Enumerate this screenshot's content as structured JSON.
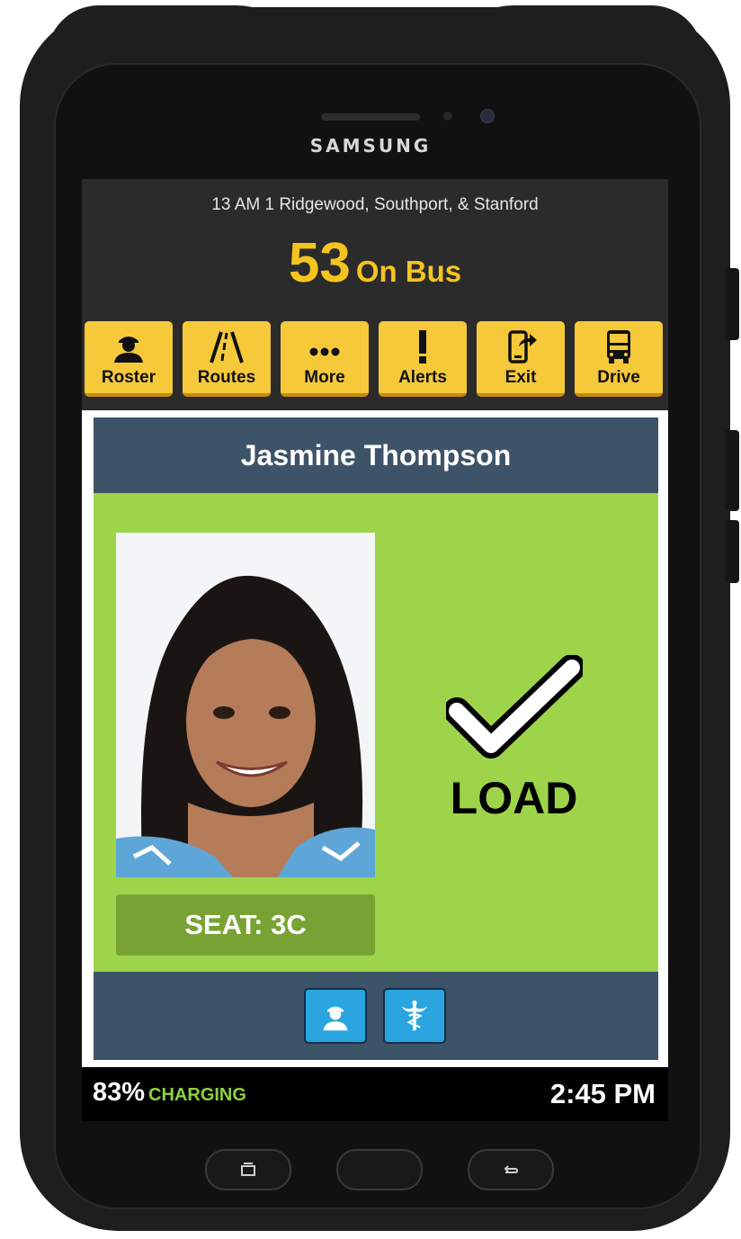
{
  "device": {
    "brand": "SAMSUNG"
  },
  "header": {
    "route_name": "13 AM 1 Ridgewood, Southport, & Stanford",
    "on_bus_count": "53",
    "on_bus_label": "On Bus",
    "accent_color": "#f6c41f"
  },
  "toolbar": {
    "items": [
      {
        "label": "Roster",
        "icon": "person-icon"
      },
      {
        "label": "Routes",
        "icon": "road-icon"
      },
      {
        "label": "More",
        "icon": "more-dots-icon"
      },
      {
        "label": "Alerts",
        "icon": "exclamation-icon"
      },
      {
        "label": "Exit",
        "icon": "phone-exit-icon"
      },
      {
        "label": "Drive",
        "icon": "bus-icon"
      }
    ]
  },
  "student": {
    "name": "Jasmine Thompson",
    "seat": "SEAT: 3C",
    "status": "LOAD",
    "status_color": "#9dd44a"
  },
  "footer_buttons": [
    {
      "icon": "student-profile-icon"
    },
    {
      "icon": "medical-caduceus-icon"
    }
  ],
  "status_bar": {
    "battery": "83%",
    "charging": "CHARGING",
    "time": "2:45 PM"
  }
}
